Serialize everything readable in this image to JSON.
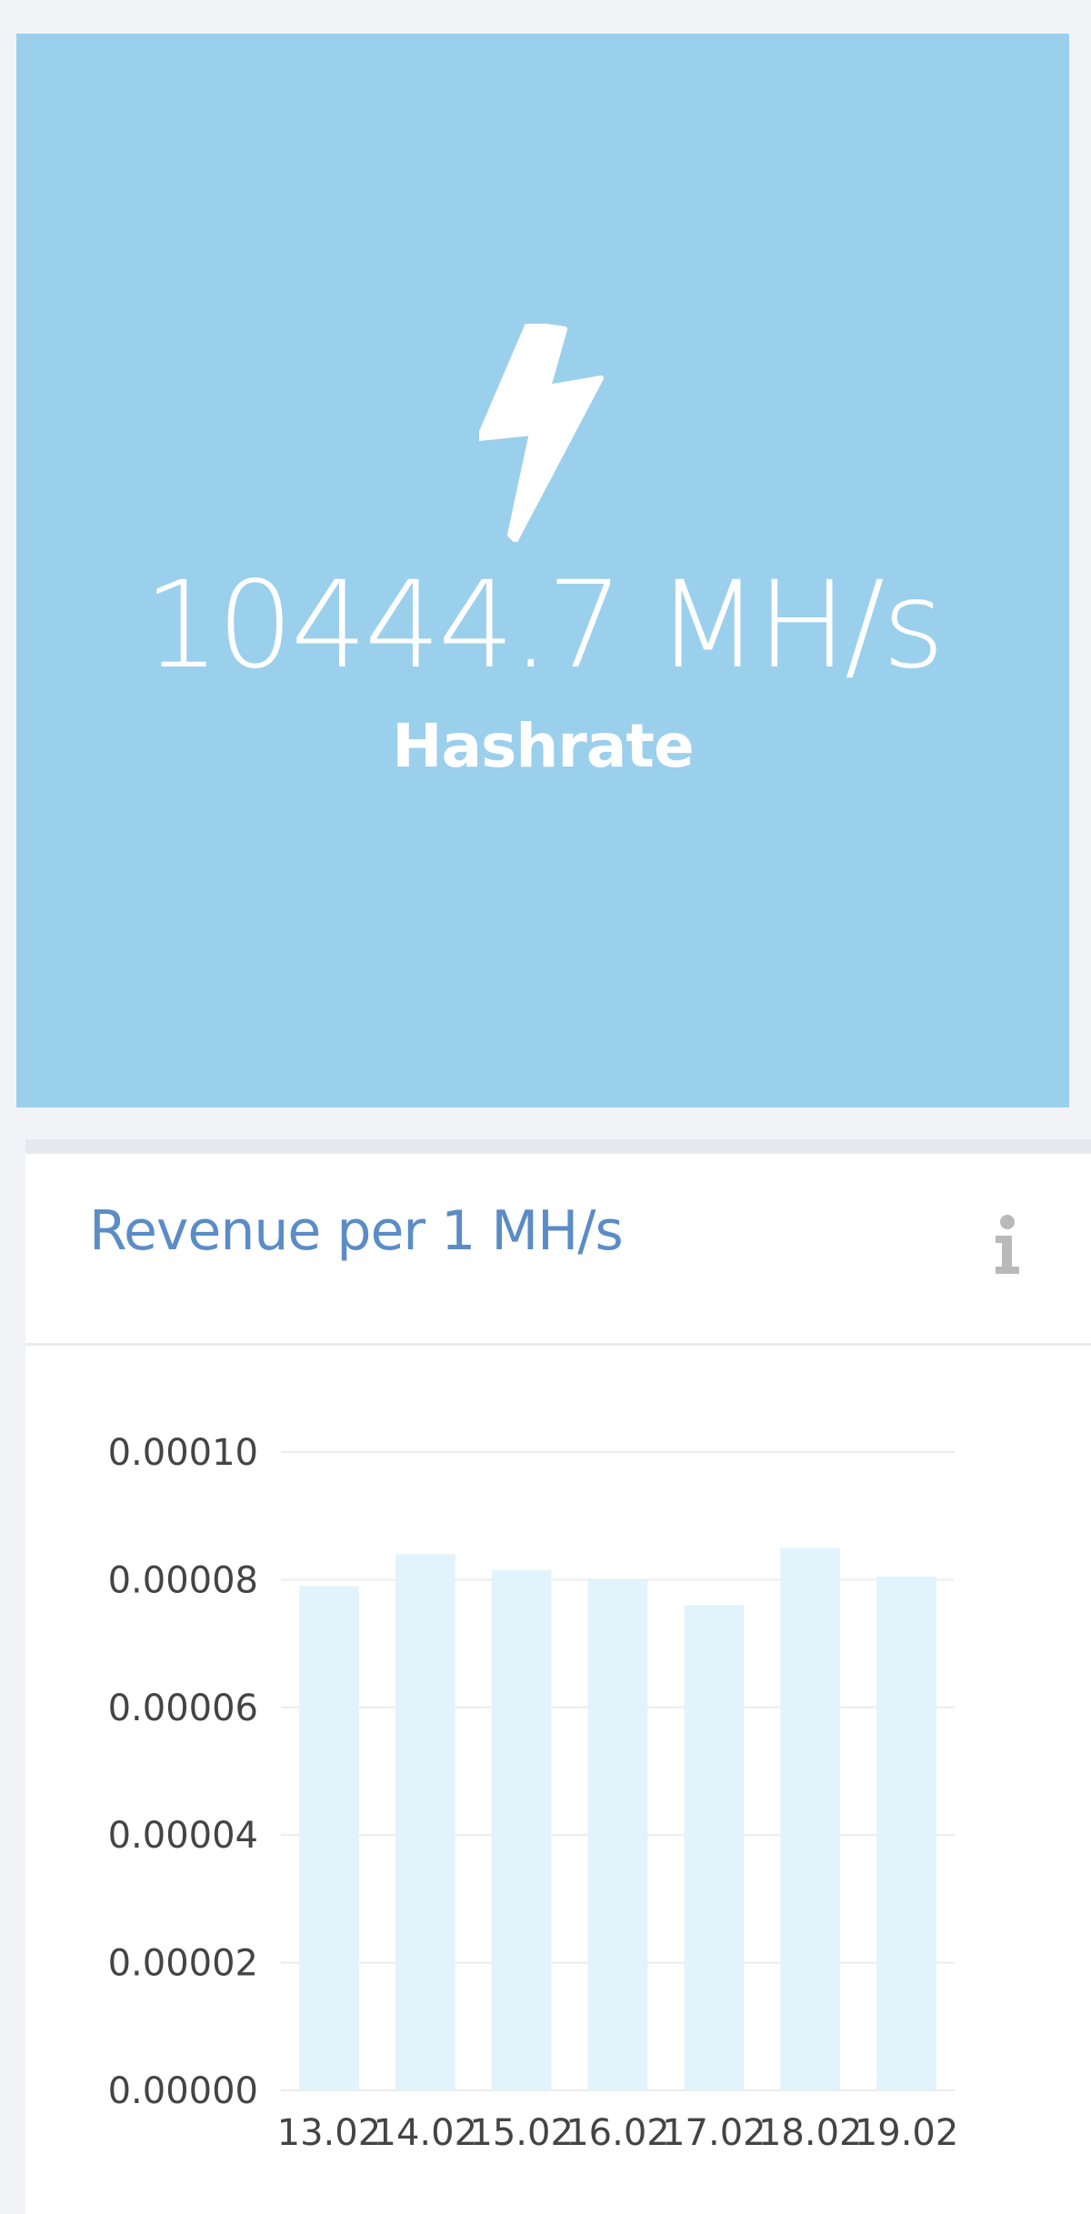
{
  "stat": {
    "value": "10444.7 MH/s",
    "label": "Hashrate",
    "icon": "bolt-icon",
    "background": "#9bd0ec"
  },
  "panel": {
    "title": "Revenue per 1 MH/s",
    "icon": "info-icon"
  },
  "chart_data": {
    "type": "bar",
    "title": "Revenue per 1 MH/s",
    "categories": [
      "13.02",
      "14.02",
      "15.02",
      "16.02",
      "17.02",
      "18.02",
      "19.02"
    ],
    "series": [
      {
        "values": [
          7.9e-05,
          8.4e-05,
          8.15e-05,
          8e-05,
          7.6e-05,
          8.5e-05,
          8.05e-05
        ]
      }
    ],
    "yticks": [
      "0.00000",
      "0.00002",
      "0.00004",
      "0.00006",
      "0.00008",
      "0.00010"
    ],
    "ylim": [
      0,
      0.0001
    ],
    "grid": true,
    "bar_color": "#e1f3fb",
    "xlabel": "",
    "ylabel": ""
  }
}
